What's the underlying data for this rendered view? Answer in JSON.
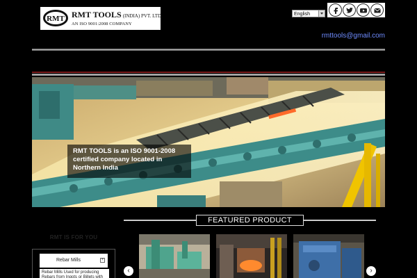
{
  "header": {
    "logo_emblem": "RMT",
    "logo_name": "RMT TOOLS",
    "logo_suffix": "(INDIA) PVT. LTD.",
    "logo_tagline": "AN ISO 9001:2008 COMPANY",
    "email": "rmttools@gmail.com"
  },
  "language": {
    "selected": "English"
  },
  "social": [
    {
      "name": "facebook-icon",
      "glyph": "f"
    },
    {
      "name": "twitter-icon",
      "glyph": "t"
    },
    {
      "name": "youtube-icon",
      "glyph": "You"
    },
    {
      "name": "mail-icon",
      "glyph": "mail"
    }
  ],
  "hero": {
    "caption": "RMT TOOLS is an ISO 9001-2008 certified company located in Northern India"
  },
  "featured": {
    "title": "FEATURED PRODUCT"
  },
  "sidebar": {
    "heading": "RMT IS FOR YOU",
    "item_label": "Rebar Mills",
    "item_desc": "Rebar Mills Used for producing Rebars from Ingots or Billets with"
  },
  "carousel": {
    "prev_icon": "chevron-left-icon",
    "next_icon": "chevron-right-icon"
  },
  "colors": {
    "background": "#000000",
    "email_link": "#6f8cff",
    "accent_red": "#7a1a1a"
  }
}
